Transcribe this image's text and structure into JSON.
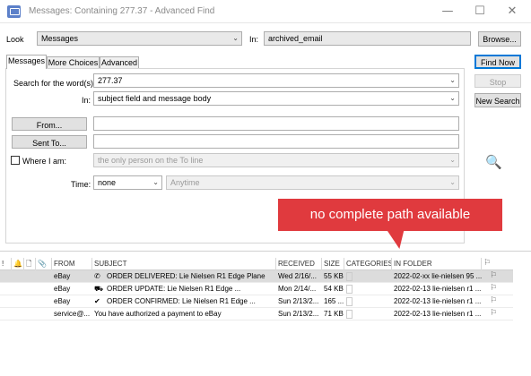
{
  "window": {
    "title": "Messages: Containing 277.37 - Advanced Find",
    "controls": {
      "minimize": "—",
      "maximize": "☐",
      "close": "✕"
    }
  },
  "look": {
    "label": "Look",
    "value": "Messages",
    "in_label": "In:",
    "in_value": "archived_email",
    "browse": "Browse..."
  },
  "actions": {
    "find_now": "Find Now",
    "stop": "Stop",
    "new_search": "New Search"
  },
  "tabs": [
    "Messages",
    "More Choices",
    "Advanced"
  ],
  "messages_tab": {
    "search_label": "Search for the word(s):",
    "search_value": "277.37",
    "in_label": "In:",
    "in_value": "subject field and message body",
    "from_button": "From...",
    "from_value": "",
    "sent_to_button": "Sent To...",
    "sent_to_value": "",
    "where_label": "Where I am:",
    "where_value": "the only person on the To line",
    "time_label": "Time:",
    "time_value": "none",
    "time_range": "Anytime"
  },
  "annotation": "no complete path available",
  "table": {
    "headers": [
      "!",
      "",
      "",
      "",
      "FROM",
      "SUBJECT",
      "RECEIVED",
      "SIZE",
      "CATEGORIES",
      "IN FOLDER",
      ""
    ],
    "rows": [
      {
        "from": "eBay",
        "icon": "✆",
        "subject": "ORDER DELIVERED: Lie Nielsen R1 Edge Plane",
        "received": "Wed 2/16/...",
        "size": "55 KB",
        "folder": "2022-02-xx lie-nielsen 95 ...",
        "selected": true
      },
      {
        "from": "eBay",
        "icon": "⛟",
        "subject": "ORDER UPDATE: Lie Nielsen R1 Edge ...",
        "received": "Mon 2/14/...",
        "size": "54 KB",
        "folder": "2022-02-13 lie-nielsen r1 ...",
        "selected": false
      },
      {
        "from": "eBay",
        "icon": "✔",
        "subject": "ORDER CONFIRMED: Lie Nielsen R1 Edge ...",
        "received": "Sun 2/13/2...",
        "size": "165 ...",
        "folder": "2022-02-13 lie-nielsen r1 ...",
        "selected": false
      },
      {
        "from": "service@...",
        "icon": "",
        "subject": "You have authorized a payment to eBay",
        "received": "Sun 2/13/2...",
        "size": "71 KB",
        "folder": "2022-02-13 lie-nielsen r1 ...",
        "selected": false
      }
    ]
  }
}
